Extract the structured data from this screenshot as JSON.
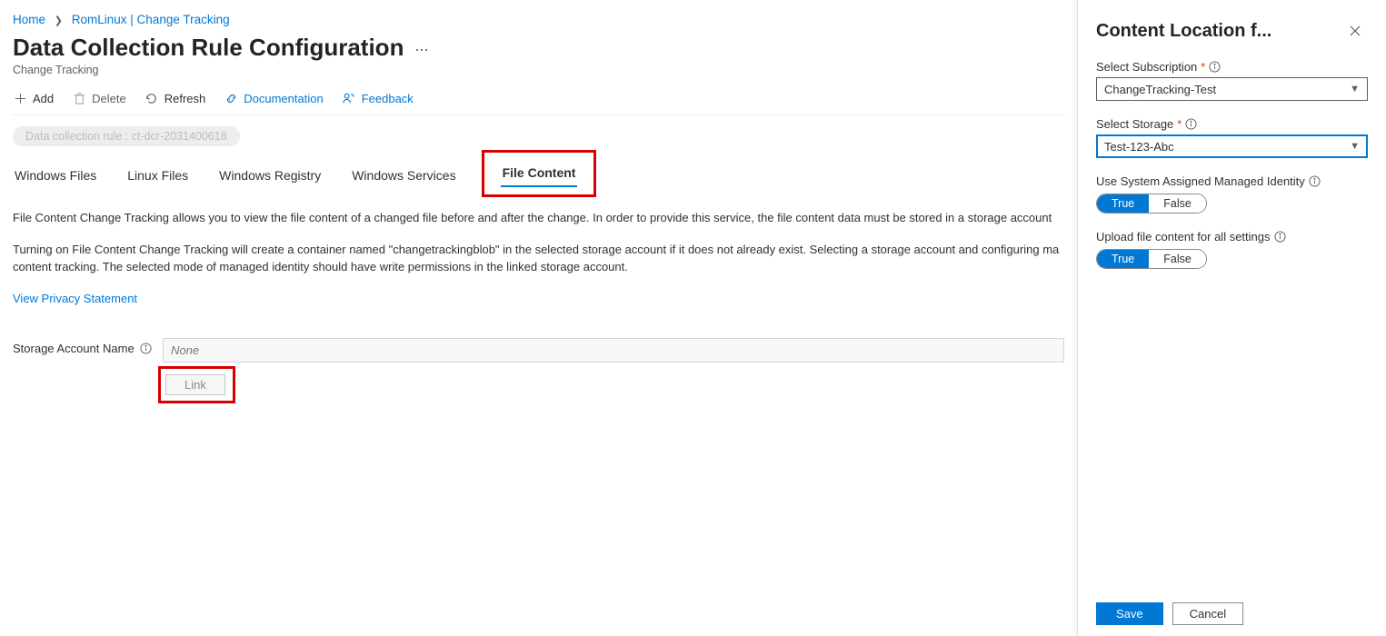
{
  "breadcrumb": {
    "home": "Home",
    "current": "RomLinux | Change Tracking"
  },
  "header": {
    "title": "Data Collection Rule Configuration",
    "subtitle": "Change Tracking",
    "more": "..."
  },
  "toolbar": {
    "add": "Add",
    "delete": "Delete",
    "refresh": "Refresh",
    "documentation": "Documentation",
    "feedback": "Feedback"
  },
  "dcr_chip": "Data collection rule : ct-dcr-2031400618",
  "tabs": {
    "windows_files": "Windows Files",
    "linux_files": "Linux Files",
    "windows_registry": "Windows Registry",
    "windows_services": "Windows Services",
    "file_content": "File Content"
  },
  "body": {
    "p1": "File Content Change Tracking allows you to view the file content of a changed file before and after the change. In order to provide this service, the file content data must be stored in a storage account",
    "p2": "Turning on File Content Change Tracking will create a container named \"changetrackingblob\" in the selected storage account if it does not already exist. Selecting a storage account and configuring ma content tracking. The selected mode of managed identity should have write permissions in the linked storage account.",
    "privacy_link": "View Privacy Statement"
  },
  "storage_field": {
    "label": "Storage Account Name",
    "placeholder": "None",
    "link_button": "Link"
  },
  "panel": {
    "title": "Content Location f...",
    "subscription": {
      "label": "Select Subscription",
      "value": "ChangeTracking-Test"
    },
    "storage": {
      "label": "Select Storage",
      "value": "Test-123-Abc"
    },
    "identity": {
      "label": "Use System Assigned Managed Identity",
      "true": "True",
      "false": "False"
    },
    "upload": {
      "label": "Upload file content for all settings",
      "true": "True",
      "false": "False"
    },
    "footer": {
      "save": "Save",
      "cancel": "Cancel"
    }
  }
}
